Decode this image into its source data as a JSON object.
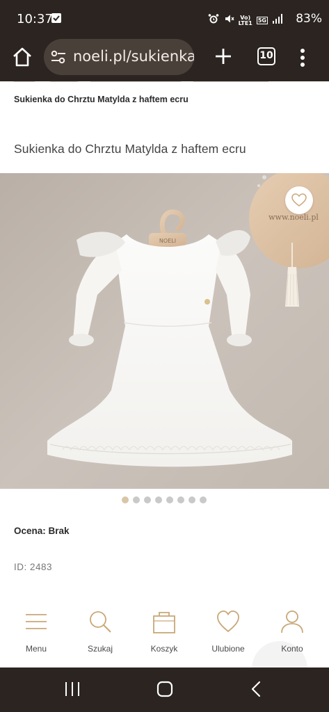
{
  "status_bar": {
    "time": "10:37",
    "battery": "83%",
    "network_badge": "5G",
    "lte_label": "LTE1"
  },
  "browser": {
    "url": "noeli.pl/sukienka-",
    "tab_count": "10"
  },
  "page": {
    "breadcrumb": "Sukienka do Chrztu Matylda z haftem ecru",
    "title": "Sukienka do Chrztu Matylda z haftem ecru",
    "image_sign": "www.noeli.pl",
    "hanger_brand": "NOELI",
    "carousel": {
      "total": 8,
      "active": 0
    },
    "rating": "Ocena: Brak",
    "product_id": "ID: 2483"
  },
  "bottom_nav": {
    "items": [
      {
        "label": "Menu",
        "icon": "hamburger-icon"
      },
      {
        "label": "Szukaj",
        "icon": "search-icon"
      },
      {
        "label": "Koszyk",
        "icon": "bag-icon"
      },
      {
        "label": "Ulubione",
        "icon": "heart-icon"
      },
      {
        "label": "Konto",
        "icon": "user-icon"
      }
    ]
  },
  "colors": {
    "bar_bg": "#2b2420",
    "accent": "#c9a777",
    "image_bg": "#c5bcb3"
  }
}
